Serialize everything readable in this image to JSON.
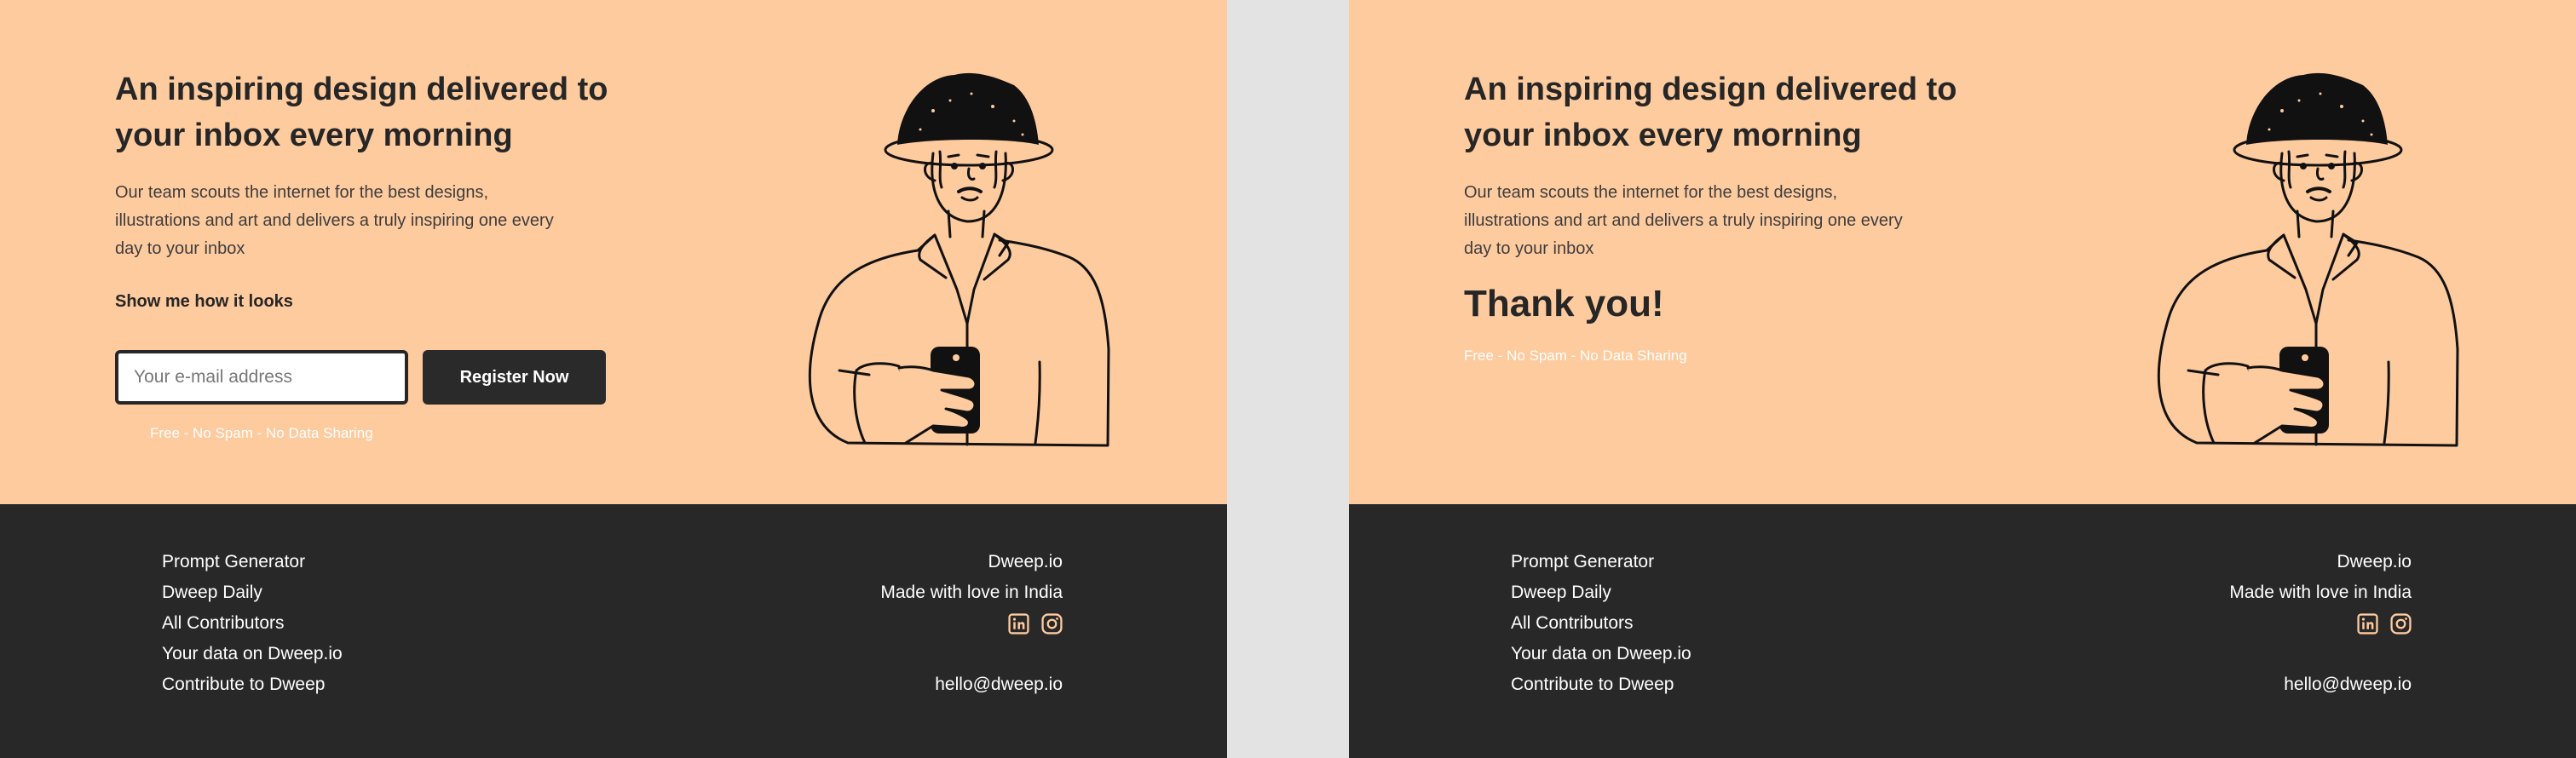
{
  "hero": {
    "headline": "An inspiring design delivered to your inbox every morning",
    "description": "Our team scouts the internet for the best designs, illustrations and art and delivers a truly inspiring one every day to your inbox",
    "show_link": "Show me how it looks",
    "email_placeholder": "Your e-mail address",
    "register_label": "Register Now",
    "tagline": "Free - No Spam - No Data Sharing",
    "thank_you": "Thank you!"
  },
  "footer": {
    "links": [
      "Prompt Generator",
      "Dweep Daily",
      "All Contributors",
      "Your data on Dweep.io",
      "Contribute to Dweep"
    ],
    "brand": "Dweep.io",
    "made_with": "Made with love in India",
    "email": "hello@dweep.io",
    "socials": [
      "linkedin-icon",
      "instagram-icon"
    ]
  },
  "colors": {
    "hero_bg": "#fecb9f",
    "footer_bg": "#282828",
    "divider_bg": "#e3e3e3",
    "text_dark": "#262626",
    "accent_icon": "#fecb9f"
  }
}
